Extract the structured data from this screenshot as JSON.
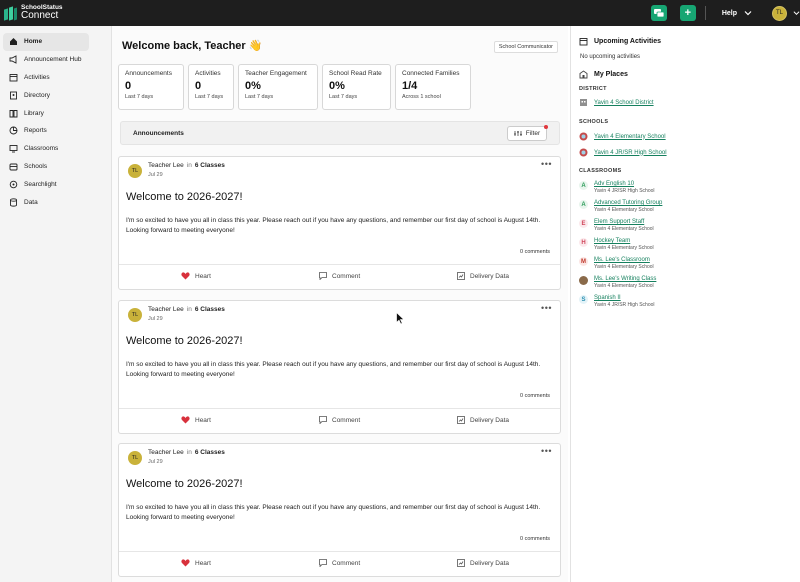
{
  "topbar": {
    "brand_line1": "SchoolStatus",
    "brand_line2": "Connect",
    "add_symbol": "+",
    "help_label": "Help",
    "avatar_initials": "TL"
  },
  "sidebar": {
    "items": [
      {
        "label": "Home",
        "icon": "home-icon"
      },
      {
        "label": "Announcement Hub",
        "icon": "megaphone-icon"
      },
      {
        "label": "Activities",
        "icon": "calendar-icon"
      },
      {
        "label": "Directory",
        "icon": "directory-icon"
      },
      {
        "label": "Library",
        "icon": "book-icon"
      },
      {
        "label": "Reports",
        "icon": "pie-chart-icon"
      },
      {
        "label": "Classrooms",
        "icon": "chalkboard-icon"
      },
      {
        "label": "Schools",
        "icon": "school-icon"
      },
      {
        "label": "Searchlight",
        "icon": "search-icon"
      },
      {
        "label": "Data",
        "icon": "database-icon"
      }
    ]
  },
  "main": {
    "welcome": "Welcome back, Teacher 👋",
    "role": "School Communicator",
    "stats": [
      {
        "label": "Announcements",
        "value": "0",
        "sub": "Last 7 days"
      },
      {
        "label": "Activities",
        "value": "0",
        "sub": "Last 7 days"
      },
      {
        "label": "Teacher Engagement",
        "value": "0%",
        "sub": "Last 7 days"
      },
      {
        "label": "School Read Rate",
        "value": "0%",
        "sub": "Last 7 days"
      },
      {
        "label": "Connected Families",
        "value": "1/4",
        "sub": "Across 1 school"
      }
    ],
    "announcements_title": "Announcements",
    "filter_label": "Filter",
    "posts": [
      {
        "initials": "TL",
        "author": "Teacher Lee",
        "in": "in",
        "classes": "6 Classes",
        "date": "Jul 29",
        "title": "Welcome to 2026-2027!",
        "body": "I'm so excited to have you all in class this year. Please reach out if you have any questions, and remember our first day of school is August 14th. Looking forward to meeting everyone!",
        "comments": "0 comments",
        "heart": "Heart",
        "comment": "Comment",
        "delivery": "Delivery Data"
      },
      {
        "initials": "TL",
        "author": "Teacher Lee",
        "in": "in",
        "classes": "6 Classes",
        "date": "Jul 29",
        "title": "Welcome to 2026-2027!",
        "body": "I'm so excited to have you all in class this year. Please reach out if you have any questions, and remember our first day of school is August 14th. Looking forward to meeting everyone!",
        "comments": "0 comments",
        "heart": "Heart",
        "comment": "Comment",
        "delivery": "Delivery Data"
      },
      {
        "initials": "TL",
        "author": "Teacher Lee",
        "in": "in",
        "classes": "6 Classes",
        "date": "Jul 29",
        "title": "Welcome to 2026-2027!",
        "body": "I'm so excited to have you all in class this year. Please reach out if you have any questions, and remember our first day of school is August 14th. Looking forward to meeting everyone!",
        "comments": "0 comments",
        "heart": "Heart",
        "comment": "Comment",
        "delivery": "Delivery Data"
      }
    ]
  },
  "right": {
    "upcoming_title": "Upcoming Activities",
    "upcoming_empty": "No upcoming activities",
    "places_title": "My Places",
    "district_label": "DISTRICT",
    "district": "Yavin 4 School District",
    "schools_label": "SCHOOLS",
    "schools": [
      "Yavin 4 Elementary School",
      "Yavin 4 JR/SR High School"
    ],
    "classrooms_label": "CLASSROOMS",
    "classrooms": [
      {
        "badge": "A",
        "name": "Adv English 10",
        "school": "Yavin 4 JR/SR High School",
        "color": "#2e9d5b"
      },
      {
        "badge": "A",
        "name": "Advanced Tutoring Group",
        "school": "Yavin 4 Elementary School",
        "color": "#2e9d5b"
      },
      {
        "badge": "E",
        "name": "Elem Support Staff",
        "school": "Yavin 4 Elementary School",
        "color": "#d0455a"
      },
      {
        "badge": "H",
        "name": "Hockey Team",
        "school": "Yavin 4 Elementary School",
        "color": "#d0455a"
      },
      {
        "badge": "M",
        "name": "Ms. Lee's Classroom",
        "school": "Yavin 4 Elementary School",
        "color": "#c0392b"
      },
      {
        "badge": "",
        "name": "Ms. Lee's Writing Class",
        "school": "Yavin 4 Elementary School",
        "color": "#8a6a4a"
      },
      {
        "badge": "S",
        "name": "Spanish II",
        "school": "Yavin 4 JR/SR High School",
        "color": "#2a8fb0"
      }
    ]
  }
}
